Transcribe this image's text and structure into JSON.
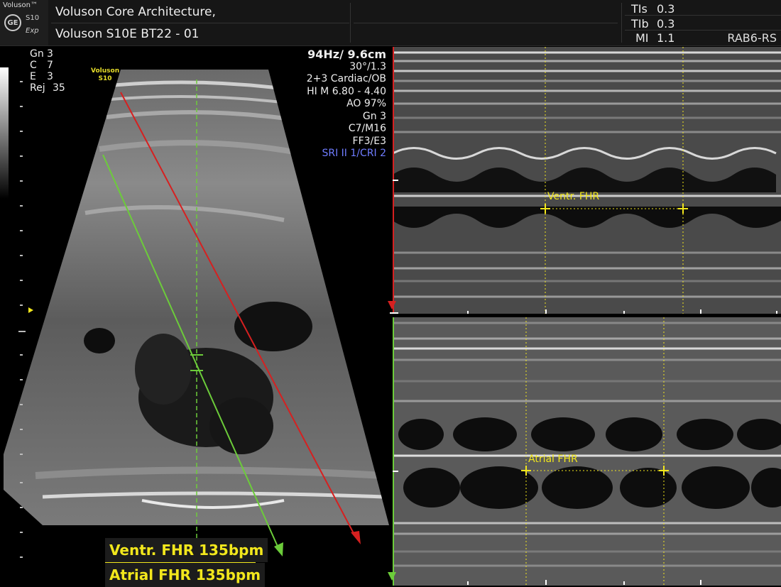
{
  "header": {
    "brand": "Voluson™",
    "logo_text": "GE",
    "model": "S10",
    "edition": "Exp",
    "title_line1": "Voluson Core Architecture,",
    "title_line2": "Voluson S10E BT22 - 01",
    "indices": [
      {
        "label": "TIs",
        "value": "0.3"
      },
      {
        "label": "TIb",
        "value": "0.3"
      },
      {
        "label": "MI",
        "value": "1.1"
      }
    ],
    "probe": "RAB6-RS"
  },
  "left_params": [
    {
      "label": "Gn",
      "value": "3"
    },
    {
      "label": "C",
      "value": "7"
    },
    {
      "label": "E",
      "value": "3"
    },
    {
      "label": "Rej",
      "value": "35"
    }
  ],
  "right_params": [
    "94Hz/ 9.6cm",
    "30°/1.3",
    "2+3 Cardiac/OB",
    "HI M  6.80 - 4.40",
    "AO 97%",
    "Gn   3",
    "C7/M16",
    "FF3/E3",
    "SRI II 1/CRI 2"
  ],
  "voluson_badge": {
    "line1": "Voluson",
    "line2": "S10"
  },
  "measurements": {
    "ventr_label": "Ventr. FHR",
    "atrial_label": "Atrial FHR",
    "ventr_result": "Ventr. FHR 135bpm",
    "atrial_result": "Atrial FHR 135bpm"
  },
  "colors": {
    "cursor_yellow": "#f2e71c",
    "line_red": "#d62020",
    "line_green": "#6ccc3a",
    "sri_blue": "#6f7cff"
  }
}
